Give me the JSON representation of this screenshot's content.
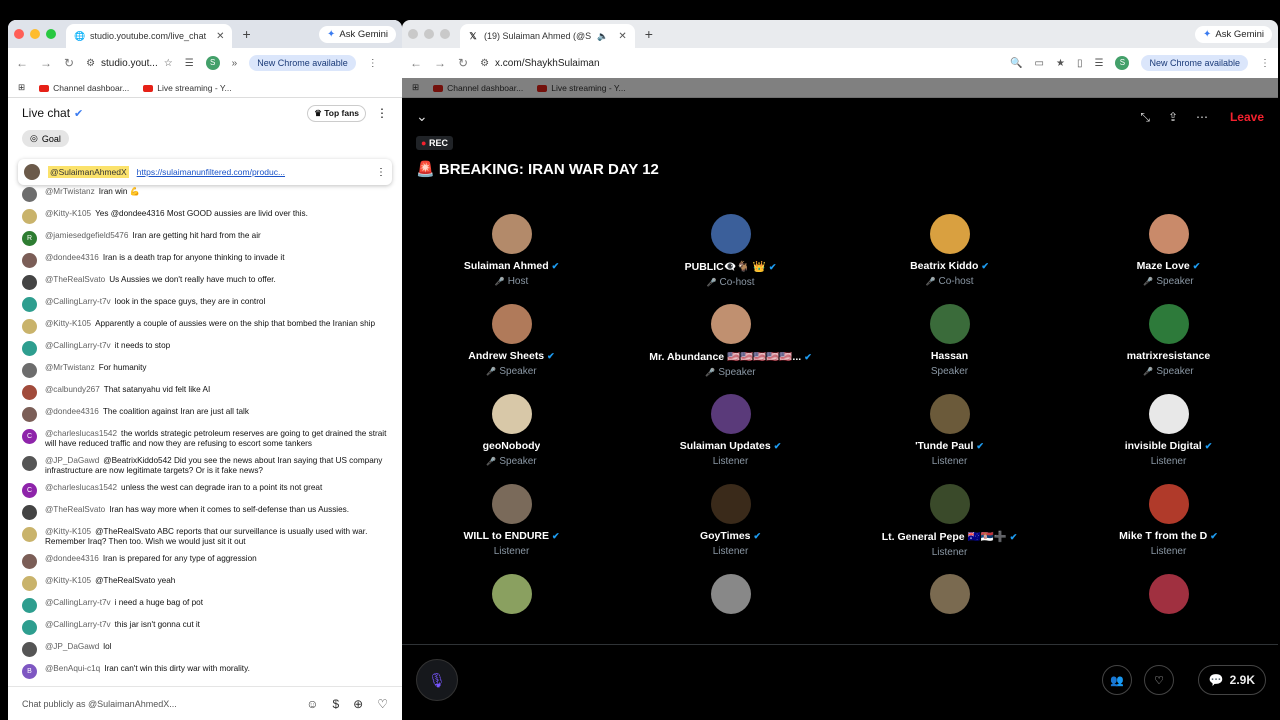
{
  "left_browser": {
    "tab_title": "studio.youtube.com/live_chat",
    "omnibox": "studio.yout...",
    "ask_gemini": "Ask Gemini",
    "new_chrome": "New Chrome available",
    "profile_letter": "S",
    "bookmarks": [
      "Channel dashboar...",
      "Live streaming - Y..."
    ]
  },
  "chat": {
    "title": "Live chat",
    "top_fans": "Top fans",
    "goal": "Goal",
    "pinned": {
      "name": "@SulaimanAhmedX",
      "link": "https://sulaimanunfiltered.com/produc..."
    },
    "messages": [
      {
        "name": "@MrTwistanz",
        "text": "Iran win 💪",
        "color": "#6d6d6d",
        "letter": ""
      },
      {
        "name": "@Kitty-K105",
        "text": "Yes @dondee4316 Most GOOD aussies are livid over this.",
        "color": "#c9b36b",
        "letter": ""
      },
      {
        "name": "@jamiesedgefield5476",
        "text": "Iran are getting hit hard from the air",
        "color": "#2e7d32",
        "letter": "R"
      },
      {
        "name": "@dondee4316",
        "text": "Iran is a death trap for anyone thinking to invade it",
        "color": "#7b5e57",
        "letter": ""
      },
      {
        "name": "@TheRealSvato",
        "text": "Us Aussies we don't really have much to offer.",
        "color": "#444444",
        "letter": ""
      },
      {
        "name": "@CallingLarry-t7v",
        "text": "look in the space guys, they are in control",
        "color": "#2e9e8f",
        "letter": ""
      },
      {
        "name": "@Kitty-K105",
        "text": "Apparently a couple of aussies were on the ship that bombed the Iranian ship",
        "color": "#c9b36b",
        "letter": ""
      },
      {
        "name": "@CallingLarry-t7v",
        "text": "it needs to stop",
        "color": "#2e9e8f",
        "letter": ""
      },
      {
        "name": "@MrTwistanz",
        "text": "For humanity",
        "color": "#6d6d6d",
        "letter": ""
      },
      {
        "name": "@calbundy267",
        "text": "That satanyahu vid felt like AI",
        "color": "#a14b3b",
        "letter": ""
      },
      {
        "name": "@dondee4316",
        "text": "The coalition against Iran are just all talk",
        "color": "#7b5e57",
        "letter": ""
      },
      {
        "name": "@charleslucas1542",
        "text": "the worlds strategic petroleum reserves are going to get drained the strait will have reduced traffic and now they are refusing to escort some tankers",
        "color": "#8e24aa",
        "letter": "C"
      },
      {
        "name": "@JP_DaGawd",
        "text": "@BeatrixKiddo542 Did you see the news about Iran saying that US company infrastructure are now legitimate targets? Or is it fake news?",
        "color": "#555555",
        "letter": ""
      },
      {
        "name": "@charleslucas1542",
        "text": "unless the west can degrade iran to a point its not great",
        "color": "#8e24aa",
        "letter": "C"
      },
      {
        "name": "@TheRealSvato",
        "text": "Iran has way more when it comes to self-defense than us Aussies.",
        "color": "#444444",
        "letter": ""
      },
      {
        "name": "@Kitty-K105",
        "text": "@TheRealSvato ABC reports that our surveillance is usually used with war. Remember Iraq? Then too. Wish we would just sit it out",
        "color": "#c9b36b",
        "letter": ""
      },
      {
        "name": "@dondee4316",
        "text": "Iran is prepared for any type of aggression",
        "color": "#7b5e57",
        "letter": ""
      },
      {
        "name": "@Kitty-K105",
        "text": "@TheRealSvato yeah",
        "color": "#c9b36b",
        "letter": ""
      },
      {
        "name": "@CallingLarry-t7v",
        "text": "i need a huge bag of pot",
        "color": "#2e9e8f",
        "letter": ""
      },
      {
        "name": "@CallingLarry-t7v",
        "text": "this jar isn't gonna cut it",
        "color": "#2e9e8f",
        "letter": ""
      },
      {
        "name": "@JP_DaGawd",
        "text": "lol",
        "color": "#555555",
        "letter": ""
      },
      {
        "name": "@BenAqui-c1q",
        "text": "Iran can't win this dirty war with morality.",
        "color": "#7e57c2",
        "letter": "B"
      }
    ],
    "input_placeholder": "Chat publicly as @SulaimanAhmedX..."
  },
  "right_browser": {
    "tab_title": "(19) Sulaiman Ahmed (@S",
    "url": "x.com/ShaykhSulaiman",
    "ask_gemini": "Ask Gemini",
    "new_chrome": "New Chrome available",
    "profile_letter": "S",
    "bookmarks": [
      "Channel dashboar...",
      "Live streaming - Y..."
    ]
  },
  "space": {
    "rec": "REC",
    "leave": "Leave",
    "title": "BREAKING: IRAN WAR DAY 12",
    "listener_count": "2.9K",
    "people": [
      {
        "name": "Sulaiman Ahmed",
        "role": "Host",
        "verified": true,
        "muted": true,
        "color": "#b38a6a"
      },
      {
        "name": "PUBLIC👁‍🗨🐐 👑",
        "role": "Co-host",
        "verified": true,
        "muted": true,
        "color": "#3b5f9a"
      },
      {
        "name": "Beatrix Kiddo",
        "role": "Co-host",
        "verified": true,
        "muted": true,
        "color": "#d9a040"
      },
      {
        "name": "Maze Love",
        "role": "Speaker",
        "verified": true,
        "muted": true,
        "color": "#c98a6a"
      },
      {
        "name": "Andrew Sheets",
        "role": "Speaker",
        "verified": true,
        "muted": true,
        "color": "#b07a5a"
      },
      {
        "name": "Mr. Abundance 🇺🇸🇺🇸🇺🇸🇺🇸🇺🇸...",
        "role": "Speaker",
        "verified": true,
        "muted": true,
        "color": "#c09070"
      },
      {
        "name": "Hassan",
        "role": "Speaker",
        "verified": false,
        "muted": false,
        "color": "#3a6b3a"
      },
      {
        "name": "matrixresistance",
        "role": "Speaker",
        "verified": false,
        "muted": true,
        "color": "#2d7a3a"
      },
      {
        "name": "geoNobody",
        "role": "Speaker",
        "verified": false,
        "muted": true,
        "color": "#d8c8a8"
      },
      {
        "name": "Sulaiman Updates",
        "role": "Listener",
        "verified": true,
        "muted": false,
        "color": "#5a3a7a"
      },
      {
        "name": "'Tunde Paul",
        "role": "Listener",
        "verified": true,
        "muted": false,
        "color": "#6b5a3a"
      },
      {
        "name": "invisible Digital",
        "role": "Listener",
        "verified": true,
        "muted": false,
        "color": "#e8e8e8"
      },
      {
        "name": "WILL to ENDURE",
        "role": "Listener",
        "verified": true,
        "muted": false,
        "color": "#7a6a5a"
      },
      {
        "name": "GoyTimes",
        "role": "Listener",
        "verified": true,
        "muted": false,
        "color": "#3a2a1a"
      },
      {
        "name": "Lt. General Pepe 🇦🇺🇷🇸➕",
        "role": "Listener",
        "verified": true,
        "muted": false,
        "color": "#3a4a2a"
      },
      {
        "name": "Mike T from the D",
        "role": "Listener",
        "verified": true,
        "muted": false,
        "color": "#b03a2a"
      },
      {
        "name": "",
        "role": "",
        "verified": false,
        "muted": false,
        "color": "#8aa060"
      },
      {
        "name": "",
        "role": "",
        "verified": false,
        "muted": false,
        "color": "#888888"
      },
      {
        "name": "",
        "role": "",
        "verified": false,
        "muted": false,
        "color": "#7a6a50"
      },
      {
        "name": "",
        "role": "",
        "verified": false,
        "muted": false,
        "color": "#a03040"
      }
    ]
  }
}
